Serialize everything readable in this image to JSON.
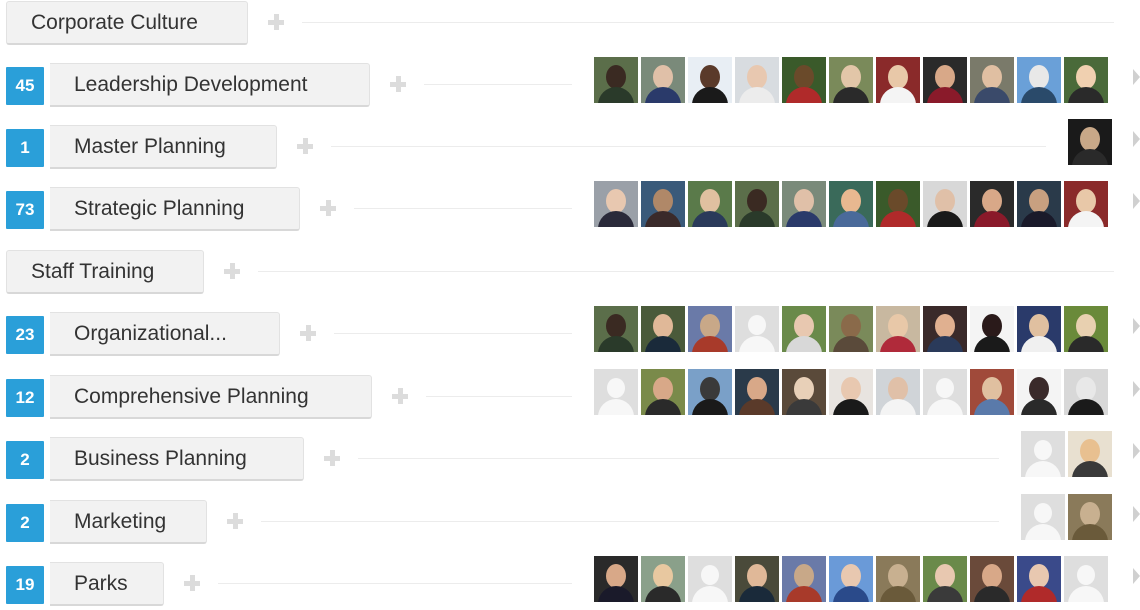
{
  "skills": [
    {
      "name": "Corporate Culture",
      "count": null,
      "avatars": []
    },
    {
      "name": "Leadership Development",
      "count": "45",
      "avatars": [
        [
          "#5b6e4a",
          "#3a2a22",
          "#2a3a2a"
        ],
        [
          "#7a8a7a",
          "#e0c0a8",
          "#2a3a6a"
        ],
        [
          "#e8eef4",
          "#5a3a2a",
          "#1a1a1a"
        ],
        [
          "#d8dce0",
          "#e8c8b0",
          "#ececec"
        ],
        [
          "#3a5a2a",
          "#6a4a2a",
          "#b02a2a"
        ],
        [
          "#7a8a5a",
          "#e2c6a8",
          "#2a2a2a"
        ],
        [
          "#8a2a2a",
          "#e8c8a8",
          "#f4f4f4"
        ],
        [
          "#2a2a2a",
          "#d8a888",
          "#8a1a2a"
        ],
        [
          "#7a7a6a",
          "#e0bfa2",
          "#3a4a6a"
        ],
        [
          "#6aa0d8",
          "#e8e8e8",
          "#2a4a6a"
        ],
        [
          "#4a6a3a",
          "#f0d0b0",
          "#2a2a2a"
        ]
      ]
    },
    {
      "name": "Master Planning",
      "count": "1",
      "avatars": [
        [
          "#1a1a1a",
          "#c8a888",
          "#2a2a2a"
        ]
      ]
    },
    {
      "name": "Strategic Planning",
      "count": "73",
      "avatars": [
        [
          "#9aa0a8",
          "#e8c8b0",
          "#2a2a3a"
        ],
        [
          "#3a5a7a",
          "#b08868",
          "#3a2a2a"
        ],
        [
          "#5a7a4a",
          "#e0c0a0",
          "#2a3a5a"
        ],
        [
          "#5b6e4a",
          "#3a2a22",
          "#2a3a2a"
        ],
        [
          "#7a8a7a",
          "#e0c0a8",
          "#2a3a6a"
        ],
        [
          "#3a6a5a",
          "#e8b890",
          "#4a6a9a"
        ],
        [
          "#3a5a2a",
          "#6a4a2a",
          "#b02a2a"
        ],
        [
          "#d8d8d8",
          "#e0c0a8",
          "#1a1a1a"
        ],
        [
          "#2a2a2a",
          "#d8a888",
          "#8a1a2a"
        ],
        [
          "#2a3a4a",
          "#c8a080",
          "#1a1a2a"
        ],
        [
          "#8a2a2a",
          "#e8c8a8",
          "#f4f4f4"
        ]
      ]
    },
    {
      "name": "Staff Training",
      "count": null,
      "avatars": []
    },
    {
      "name": "Organizational...",
      "count": "23",
      "avatars": [
        [
          "#5b6e4a",
          "#3a2a22",
          "#2a3a2a"
        ],
        [
          "#4a5a3a",
          "#e0b898",
          "#1a2a3a"
        ],
        [
          "#6a7aa8",
          "#c8a888",
          "#a83a2a"
        ],
        "placeholder",
        [
          "#6a8a4a",
          "#e8c8b0",
          "#d8d8d8"
        ],
        [
          "#7a8a5a",
          "#8a6a4a",
          "#5a4a3a"
        ],
        [
          "#c8b8a0",
          "#e8c8a8",
          "#b02a3a"
        ],
        [
          "#3a2a2a",
          "#e0b090",
          "#2a3a5a"
        ],
        [
          "#f4f4f4",
          "#2a1a1a",
          "#1a1a1a"
        ],
        [
          "#2a3a6a",
          "#e0c0a0",
          "#f0f0f0"
        ],
        [
          "#6a8a3a",
          "#e8d0b0",
          "#2a2a2a"
        ]
      ]
    },
    {
      "name": "Comprehensive Planning",
      "count": "12",
      "avatars": [
        "placeholder",
        [
          "#7a8a4a",
          "#d8a888",
          "#2a2a2a"
        ],
        [
          "#7aa0c8",
          "#3a3a3a",
          "#1a1a1a"
        ],
        [
          "#2a3a4a",
          "#d8a888",
          "#5a3a2a"
        ],
        [
          "#5a4a3a",
          "#e8d0b8",
          "#3a3a3a"
        ],
        [
          "#e8e4e0",
          "#e8c8b0",
          "#1a1a1a"
        ],
        [
          "#d0d4d8",
          "#e0c0a8",
          "#f4f4f4"
        ],
        "placeholder",
        [
          "#a04a3a",
          "#e0c0a0",
          "#5a7aaa"
        ],
        [
          "#f4f4f4",
          "#3a2a2a",
          "#2a2a2a"
        ],
        [
          "#d8d8d8",
          "#e8e8e8",
          "#1a1a1a"
        ]
      ]
    },
    {
      "name": "Business Planning",
      "count": "2",
      "avatars": [
        "placeholder",
        [
          "#e8e0d0",
          "#e8c090",
          "#3a3a3a"
        ]
      ]
    },
    {
      "name": "Marketing",
      "count": "2",
      "avatars": [
        "placeholder",
        [
          "#8a7a5a",
          "#c8b090",
          "#6a5a3a"
        ]
      ]
    },
    {
      "name": "Parks",
      "count": "19",
      "avatars": [
        [
          "#2a2a2a",
          "#d8a888",
          "#1a1a2a"
        ],
        [
          "#8aa08a",
          "#e8c8a0",
          "#2a2a2a"
        ],
        "placeholder",
        [
          "#4a4a3a",
          "#e0b898",
          "#1a2a3a"
        ],
        [
          "#6a7aa8",
          "#c8a888",
          "#a83a2a"
        ],
        [
          "#6a9ad8",
          "#e8c8b0",
          "#2a4a8a"
        ],
        [
          "#8a7a5a",
          "#c8b090",
          "#6a5a3a"
        ],
        [
          "#6a8a4a",
          "#e8c8b0",
          "#3a3a3a"
        ],
        [
          "#6a4a3a",
          "#d8a888",
          "#2a2a2a"
        ],
        [
          "#3a4a8a",
          "#e8c8b0",
          "#b02a2a"
        ],
        "placeholder"
      ]
    }
  ]
}
